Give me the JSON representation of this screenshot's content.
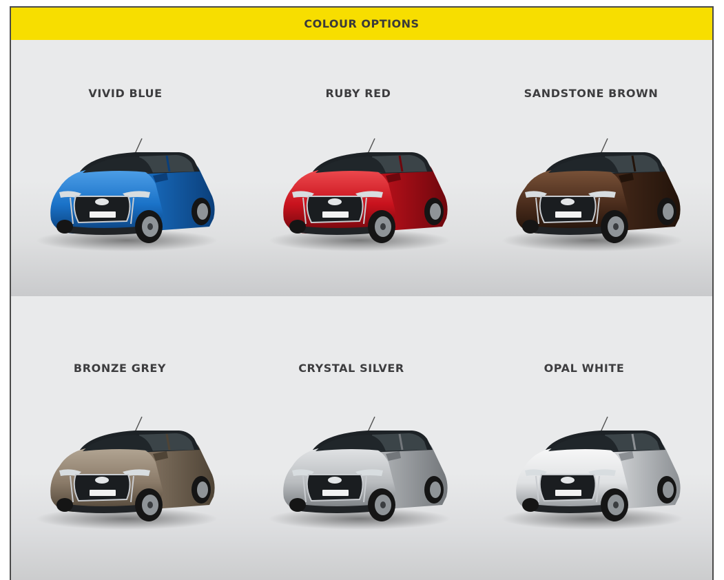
{
  "header": {
    "title": "COLOUR OPTIONS",
    "background": "#f7de00"
  },
  "colours": [
    {
      "name": "VIVID BLUE",
      "body": "#1a72c8",
      "light": "#4fa0e8",
      "dark": "#0b3f7a"
    },
    {
      "name": "RUBY RED",
      "body": "#c8121d",
      "light": "#ee4b4f",
      "dark": "#6e070d"
    },
    {
      "name": "SANDSTONE BROWN",
      "body": "#4a2c1c",
      "light": "#7a5339",
      "dark": "#22130a"
    },
    {
      "name": "BRONZE GREY",
      "body": "#8a7a68",
      "light": "#b3a694",
      "dark": "#4f4436"
    },
    {
      "name": "CRYSTAL SILVER",
      "body": "#b9bcbf",
      "light": "#e2e4e6",
      "dark": "#73777b"
    },
    {
      "name": "OPAL WHITE",
      "body": "#dfe1e3",
      "light": "#f8f8f8",
      "dark": "#8c9094"
    }
  ]
}
